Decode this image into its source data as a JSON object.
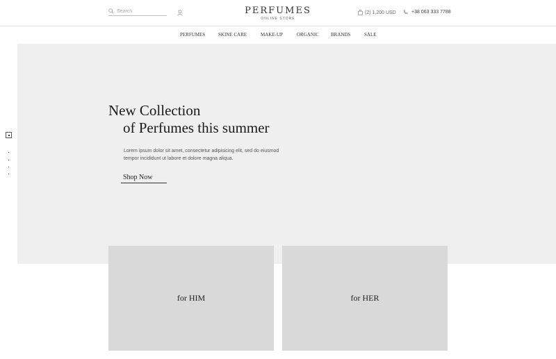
{
  "header": {
    "search_placeholder": "Search",
    "logo_title": "PERFUMES",
    "logo_subtitle": "ONLINE STORE",
    "cart_text": "(2)  1,200 USD",
    "phone": "+38 063 333 7788"
  },
  "nav": {
    "items": [
      "PERFUMES",
      "SKINE CARE",
      "MAKE-UP",
      "ORGANIC",
      "BRANDS",
      "SALE"
    ]
  },
  "hero": {
    "title_line1": "New Collection",
    "title_line2": "of Perfumes this summer",
    "description": "Lorem ipsum dolor sit amet, consectetur adipisicing elit, sed do eiusmod tempor incididunt ut labore et dolore magna aliqua.",
    "button_label": "Shop Now",
    "background_color": "#efefef"
  },
  "categories": [
    {
      "label": "for HIM"
    },
    {
      "label": "for HER"
    }
  ]
}
